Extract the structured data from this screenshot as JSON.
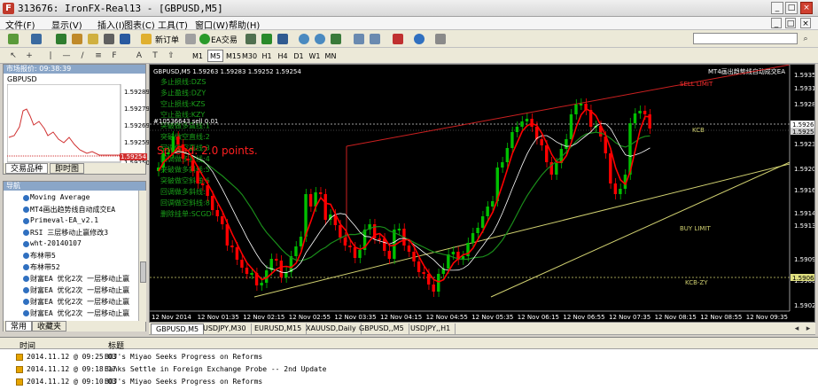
{
  "window": {
    "title": "313676: IronFX-Real13 - [GBPUSD,M5]"
  },
  "menu": [
    "文件(F)",
    "显示(V)",
    "插入(I)",
    "图表(C)",
    "工具(T)",
    "窗口(W)",
    "帮助(H)"
  ],
  "toolbar": {
    "new_order_label": "新订单",
    "ea_label": "EA交易",
    "timeframes": [
      "M1",
      "M5",
      "M15",
      "M30",
      "H1",
      "H4",
      "D1",
      "W1",
      "MN"
    ],
    "active_timeframe": "M5"
  },
  "market_watch": {
    "header": "市场报价: 09:38:39",
    "symbol": "GBPUSD",
    "prices": [
      "1.59289",
      "1.59279",
      "1.59269",
      "1.59259",
      "1.59254",
      "1.59250"
    ],
    "tabs": [
      "交易品种",
      "即时图"
    ]
  },
  "navigator": {
    "header": "导航",
    "items": [
      "Moving Average",
      "MT4画出趋势线自动成交EA",
      "Primeval-EA_v2.1",
      "RSI 三层移动止赢修改3",
      "wht-20140107",
      "布林带5",
      "布林带52",
      "财富EA 优化2次 一层移动止赢",
      "财富EA 优化2次 一层移动止赢",
      "财富EA 优化2次 一层移动止赢",
      "财富EA 优化2次 一层移动止赢"
    ],
    "tabs": [
      "常用",
      "收藏夹"
    ]
  },
  "chart": {
    "header": "GBPUSD,M5  1.59263 1.59283 1.59252 1.59254",
    "ea_name": "MT4画出趋势线自动成交EA",
    "order_line": "#10536643 sell 0.01",
    "spread_text": "Spread: 2.0 points.",
    "status_lines": [
      "多止损线:DZS",
      "多止盈线:DZY",
      "空止损线:KZS",
      "空止盈线:KZY",
      "突破做多直线:1",
      "突破做空直线:2",
      "回调做空直线:3",
      "回调做多直线:4",
      "突破做多斜线:5",
      "突破做空斜线:6",
      "回调做多斜线:7",
      "回调做空斜线:8",
      "删除挂单:SCGD"
    ],
    "line_labels": {
      "sell_limit": "SELL LIMIT",
      "kcb": "KCB",
      "buy_limit": "BUY LIMIT",
      "kcb_zy": "KCB-ZY"
    },
    "price_axis": [
      "1.59350",
      "1.59315",
      "1.59280",
      "1.59264",
      "1.59254",
      "1.59235",
      "1.59200",
      "1.59165",
      "1.59148",
      "1.59130",
      "1.59095",
      "1.59064",
      "1.59060",
      "1.59025"
    ],
    "highlight_prices": {
      "bid": "1.59254",
      "kcb": "1.59264",
      "kcb_zy": "1.59064"
    },
    "time_axis": [
      "12 Nov 2014",
      "12 Nov 01:35",
      "12 Nov 02:15",
      "12 Nov 02:55",
      "12 Nov 03:35",
      "12 Nov 04:15",
      "12 Nov 04:55",
      "12 Nov 05:35",
      "12 Nov 06:15",
      "12 Nov 06:55",
      "12 Nov 07:35",
      "12 Nov 08:15",
      "12 Nov 08:55",
      "12 Nov 09:35"
    ],
    "colors": {
      "up": "#00c000",
      "down": "#ff0000",
      "bg": "#000000",
      "sell_limit_line": "#cc2020",
      "buy_limit_line": "#d0d070",
      "ma_green": "#1a8c1a",
      "ma_white": "#ffffff",
      "ma_red": "#ff0000"
    }
  },
  "chart_tabs": [
    "GBPUSD,M5",
    "USDJPY,M30",
    "EURUSD,M15",
    "XAUUSD,Daily",
    "GBPUSD,,M5",
    "USDJPY,,H1"
  ],
  "terminal": {
    "columns": [
      "时间",
      "标题"
    ],
    "news": [
      {
        "time": "2014.11.12 @ 09:25:03",
        "title": "BOJ's Miyao Seeks Progress on Reforms"
      },
      {
        "time": "2014.11.12 @ 09:18:17",
        "title": "Banks Settle in Foreign Exchange Probe -- 2nd Update"
      },
      {
        "time": "2014.11.12 @ 09:10:03",
        "title": "BOJ's Miyao Seeks Progress on Reforms"
      }
    ]
  }
}
